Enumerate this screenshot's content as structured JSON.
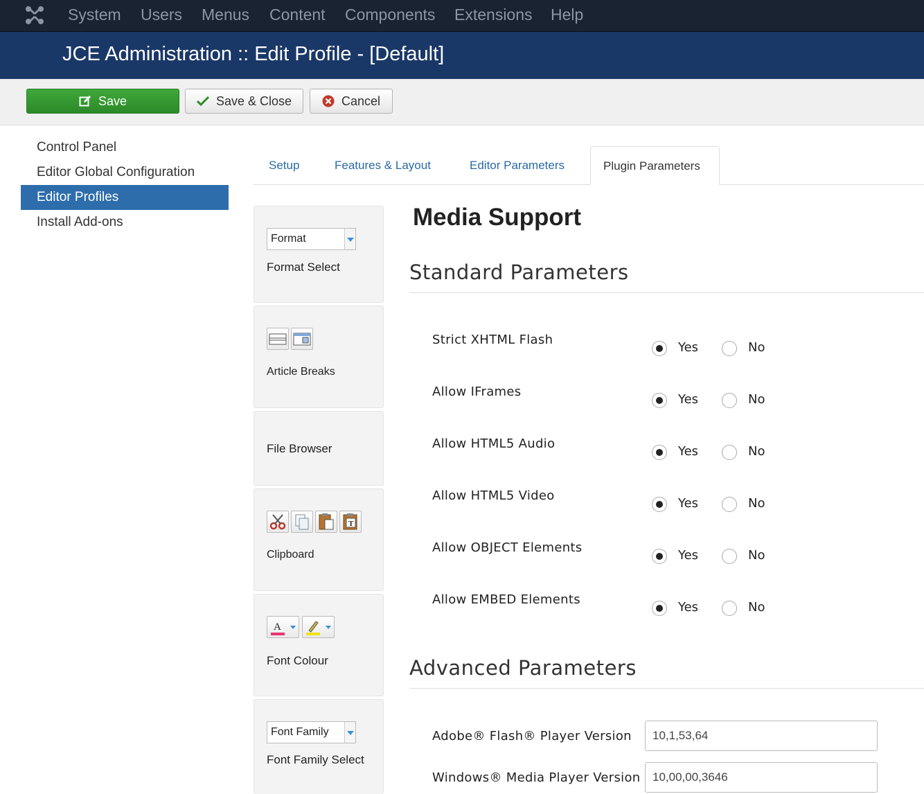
{
  "navbar": {
    "items": [
      "System",
      "Users",
      "Menus",
      "Content",
      "Components",
      "Extensions",
      "Help"
    ]
  },
  "header": {
    "title": "JCE Administration :: Edit Profile - [Default]"
  },
  "toolbar": {
    "save_label": "Save",
    "save_close_label": "Save & Close",
    "cancel_label": "Cancel"
  },
  "sidebar": {
    "items": [
      {
        "label": "Control Panel"
      },
      {
        "label": "Editor Global Configuration"
      },
      {
        "label": "Editor Profiles",
        "active": true
      },
      {
        "label": "Install Add-ons"
      }
    ]
  },
  "tabs": [
    {
      "label": "Setup"
    },
    {
      "label": "Features & Layout"
    },
    {
      "label": "Editor Parameters"
    },
    {
      "label": "Plugin Parameters",
      "active": true
    }
  ],
  "plugins": [
    {
      "label": "Format Select",
      "select_value": "Format"
    },
    {
      "label": "Article Breaks"
    },
    {
      "label": "File Browser"
    },
    {
      "label": "Clipboard"
    },
    {
      "label": "Font Colour",
      "swatch_colors": [
        "#e8366c",
        "#f0e20f"
      ]
    },
    {
      "label": "Font Family Select",
      "select_value": "Font Family"
    }
  ],
  "main": {
    "title": "Media Support",
    "standard_heading": "Standard Parameters",
    "advanced_heading": "Advanced Parameters",
    "yes_label": "Yes",
    "no_label": "No",
    "standard_params": [
      {
        "label": "Strict XHTML Flash",
        "value": "Yes"
      },
      {
        "label": "Allow IFrames",
        "value": "Yes"
      },
      {
        "label": "Allow HTML5 Audio",
        "value": "Yes"
      },
      {
        "label": "Allow HTML5 Video",
        "value": "Yes"
      },
      {
        "label": "Allow OBJECT Elements",
        "value": "Yes"
      },
      {
        "label": "Allow EMBED Elements",
        "value": "Yes"
      }
    ],
    "advanced_params": [
      {
        "label": "Adobe® Flash® Player Version",
        "value": "10,1,53,64"
      },
      {
        "label": "Windows® Media Player Version",
        "value": "10,00,00,3646"
      }
    ]
  },
  "colors": {
    "navbar": "#1a2332",
    "header": "#1a3867",
    "accent": "#2d6dab",
    "save": "#2f8f2c",
    "link": "#2a69a4"
  }
}
